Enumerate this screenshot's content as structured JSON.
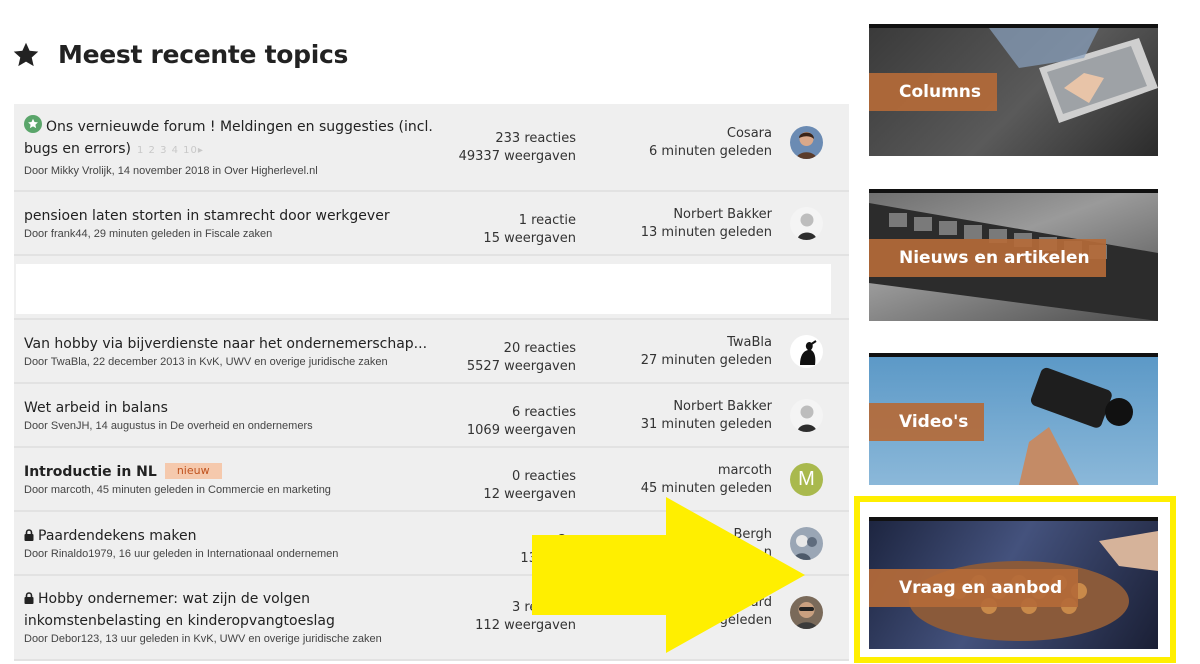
{
  "section_title": "Meest recente topics",
  "topics": [
    {
      "title": "Ons vernieuwde forum ! Meldingen en suggesties (incl. bugs en errors)",
      "pages": "1 2 3 4 10▸",
      "meta": "Door Mikky Vrolijk, 14 november 2018 in Over Higherlevel.nl",
      "replies": "233 reacties",
      "views": "49337 weergaven",
      "last_user": "Cosara",
      "last_time": "6 minuten geleden"
    },
    {
      "title": "pensioen laten storten in stamrecht door werkgever",
      "meta": "Door frank44, 29 minuten geleden in Fiscale zaken",
      "replies": "1 reactie",
      "views": "15 weergaven",
      "last_user": "Norbert Bakker",
      "last_time": "13 minuten geleden"
    },
    {
      "title": "Van hobby via bijverdienste naar het ondernemerschap...",
      "meta": "Door TwaBla, 22 december 2013 in KvK, UWV en overige juridische zaken",
      "replies": "20 reacties",
      "views": "5527 weergaven",
      "last_user": "TwaBla",
      "last_time": "27 minuten geleden"
    },
    {
      "title": "Wet arbeid in balans",
      "meta": "Door SvenJH, 14 augustus in De overheid en ondernemers",
      "replies": "6 reacties",
      "views": "1069 weergaven",
      "last_user": "Norbert Bakker",
      "last_time": "31 minuten geleden"
    },
    {
      "title": "Introductie in NL",
      "badge": "nieuw",
      "meta": "Door marcoth, 45 minuten geleden in Commercie en marketing",
      "replies": "0 reacties",
      "views": "12 weergaven",
      "last_user": "marcoth",
      "last_time": "45 minuten geleden",
      "avatar_letter": "M"
    },
    {
      "title": "Paardendekens maken",
      "meta": "Door Rinaldo1979, 16 uur geleden in Internationaal ondernemen",
      "replies": "2 r",
      "views": "133 wee",
      "last_user": "Bergh",
      "last_user_prefix": "H",
      "last_time": "n"
    },
    {
      "title": "Hobby ondernemer: wat zijn de volgen inkomstenbelasting en kinderopvangtoeslag",
      "meta": "Door Debor123, 13 uur geleden in KvK, UWV en overige juridische zaken",
      "replies": "3 reacties",
      "views": "112 weergaven",
      "last_user": "ward",
      "last_time": "ur geleden"
    }
  ],
  "sidebar": [
    {
      "label": "Columns"
    },
    {
      "label": "Nieuws en artikelen"
    },
    {
      "label": "Video's"
    },
    {
      "label": "Vraag en aanbod"
    }
  ],
  "colors": {
    "accent": "#b46a38",
    "highlight": "#ffef00",
    "badge_bg": "#f5c9ad",
    "green_icon": "#5aa56a"
  }
}
